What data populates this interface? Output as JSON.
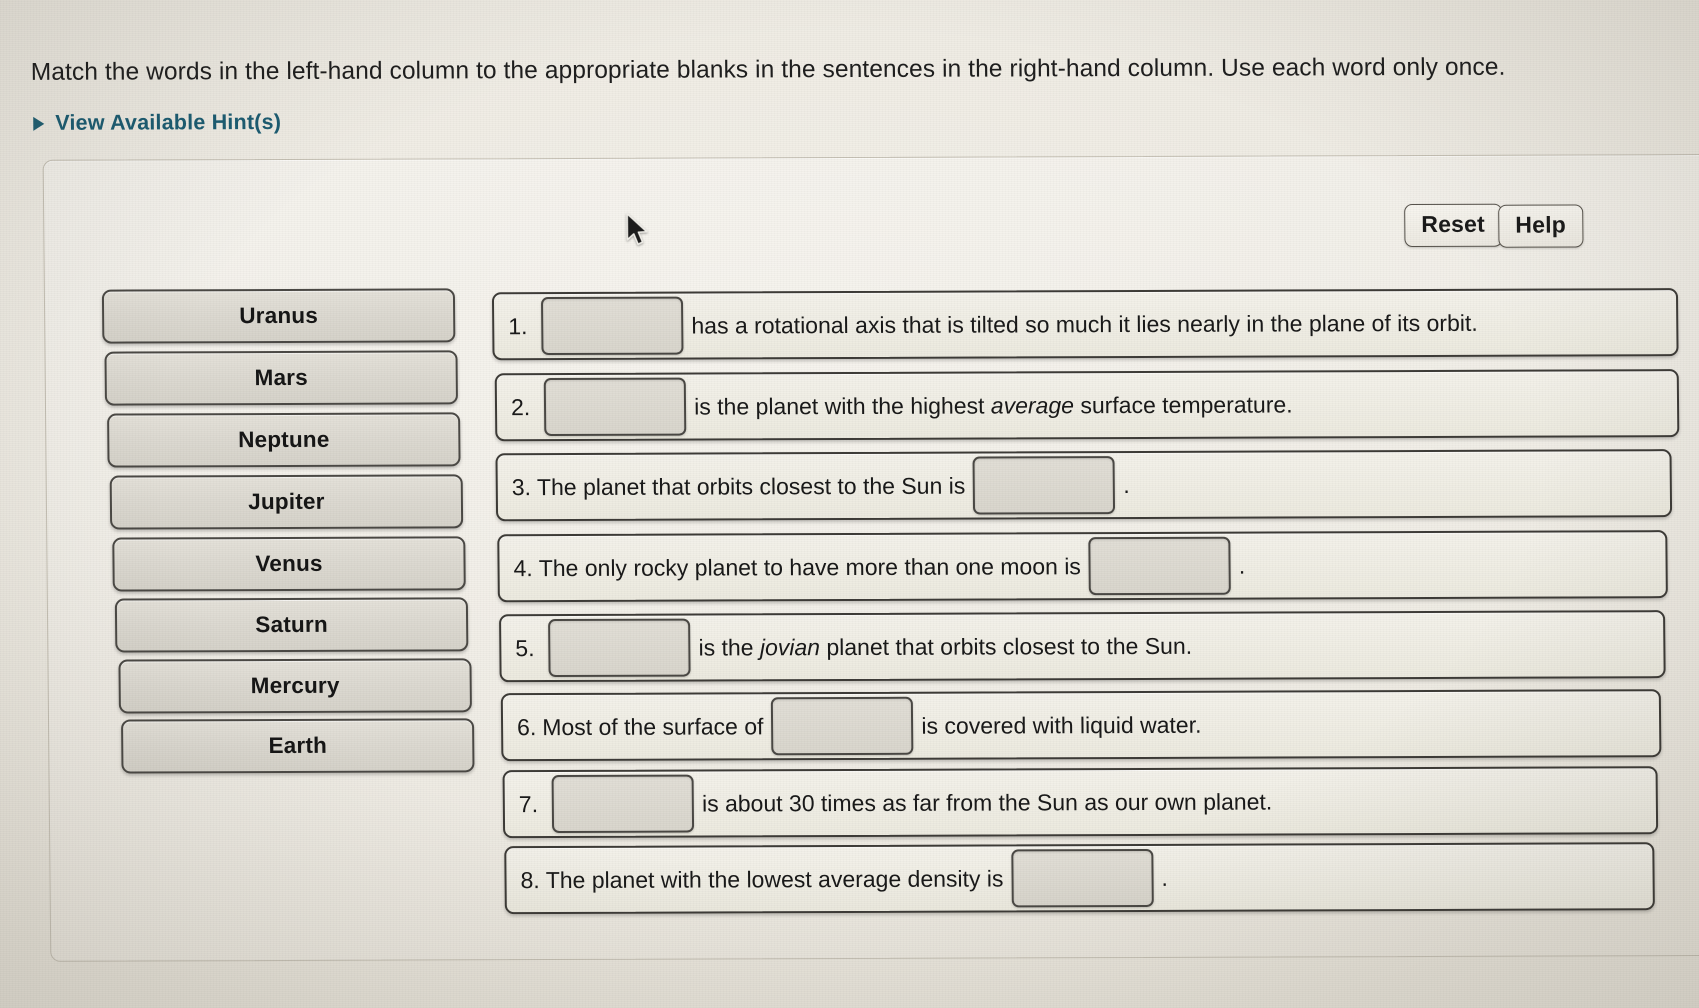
{
  "prompt": "Match the words in the left-hand column to the appropriate blanks in the sentences in the right-hand column. Use each word only once.",
  "hints": {
    "label": "View Available Hint(s)",
    "icon": "triangle-right-icon",
    "color": "#1b5c72"
  },
  "toolbar": {
    "reset_label": "Reset",
    "help_label": "Help"
  },
  "wordbank": {
    "items": [
      {
        "label": "Uranus"
      },
      {
        "label": "Mars"
      },
      {
        "label": "Neptune"
      },
      {
        "label": "Jupiter"
      },
      {
        "label": "Venus"
      },
      {
        "label": "Saturn"
      },
      {
        "label": "Mercury"
      },
      {
        "label": "Earth"
      }
    ]
  },
  "sentences": [
    {
      "number": "1.",
      "blank_first": true,
      "before": "",
      "after": "has a rotational axis that is tilted so much it lies nearly in the plane of its orbit.",
      "answer": ""
    },
    {
      "number": "2.",
      "blank_first": true,
      "before": "",
      "after_pre": "is the planet with the highest ",
      "after_italic": "average",
      "after_post": " surface temperature.",
      "answer": ""
    },
    {
      "number": "3.",
      "blank_first": false,
      "before": "The planet that orbits closest to the Sun is",
      "after": ".",
      "answer": ""
    },
    {
      "number": "4.",
      "blank_first": false,
      "before": "The only rocky planet to have more than one moon is",
      "after": ".",
      "answer": ""
    },
    {
      "number": "5.",
      "blank_first": true,
      "before": "",
      "after_pre": "is the ",
      "after_italic": "jovian",
      "after_post": " planet that orbits closest to the Sun.",
      "answer": ""
    },
    {
      "number": "6.",
      "blank_first": false,
      "before": "Most of the surface of",
      "after": "is covered with liquid water.",
      "answer": ""
    },
    {
      "number": "7.",
      "blank_first": true,
      "before": "",
      "after": "is about 30 times as far from the Sun as our own planet.",
      "answer": ""
    },
    {
      "number": "8.",
      "blank_first": false,
      "before": "The planet with the lowest average density is",
      "after": ".",
      "answer": ""
    }
  ],
  "cursor": {
    "icon": "mouse-pointer-icon"
  }
}
